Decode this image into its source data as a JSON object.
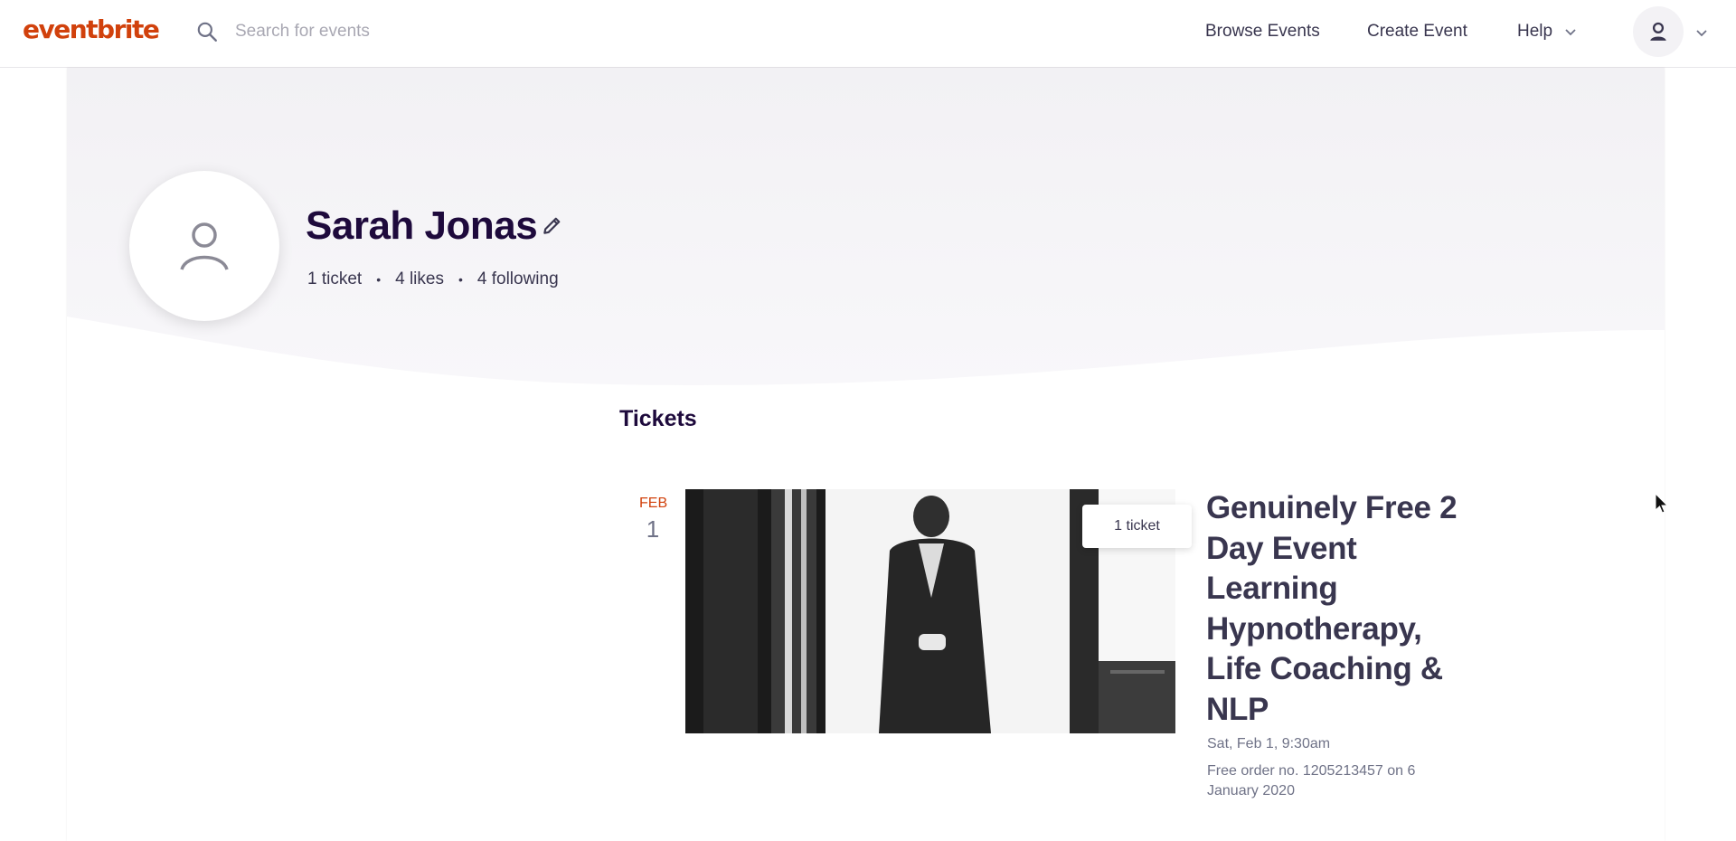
{
  "header": {
    "logo": "eventbrite",
    "search_placeholder": "Search for events",
    "nav": {
      "browse": "Browse Events",
      "create": "Create Event",
      "help": "Help"
    }
  },
  "profile": {
    "name": "Sarah Jonas",
    "stats": {
      "tickets": "1 ticket",
      "likes": "4 likes",
      "following": "4 following"
    },
    "separator": "•"
  },
  "tickets_section": {
    "title": "Tickets",
    "items": [
      {
        "month": "FEB",
        "day": "1",
        "badge": "1 ticket",
        "title": "Genuinely Free 2 Day Event Learning Hypnotherapy, Life Coaching & NLP",
        "date_time": "Sat, Feb 1, 9:30am",
        "order": "Free order no. 1205213457 on 6 January 2020"
      }
    ]
  },
  "colors": {
    "brand": "#d1410c",
    "text_dark": "#1e0a3c",
    "text_muted": "#6f7287"
  },
  "icons": [
    "search-icon",
    "chevron-down-icon",
    "user-icon",
    "pencil-icon",
    "cursor-icon"
  ]
}
